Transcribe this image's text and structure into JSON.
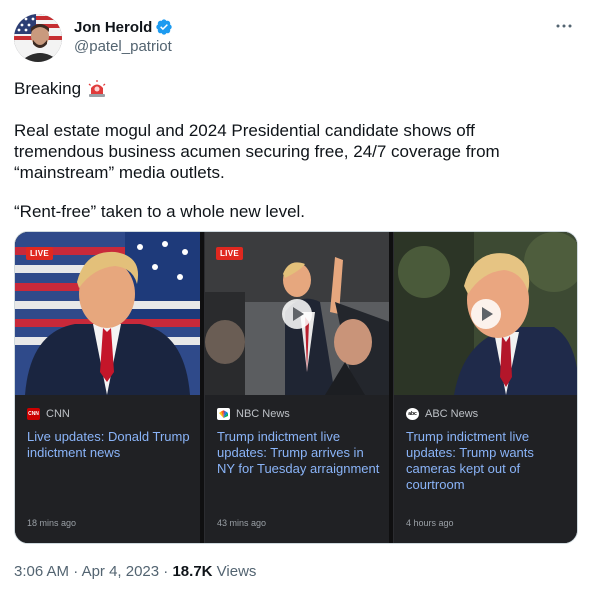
{
  "author": {
    "display_name": "Jon Herold",
    "handle": "@patel_patriot"
  },
  "tweet": {
    "line1": "Breaking",
    "para2_lines": [
      "Real estate mogul and 2024 Presidential candidate shows off",
      "tremendous business acumen securing free, 24/7 coverage from",
      "“mainstream” media outlets."
    ],
    "para3": "“Rent-free” taken to a whole new level."
  },
  "cards": [
    {
      "badge": "LIVE",
      "source": "CNN",
      "source_logo_text": "CNN",
      "headline": "Live updates: Donald Trump indictment news",
      "age": "18 mins ago"
    },
    {
      "badge": "LIVE",
      "source": "NBC News",
      "headline": "Trump indictment live updates: Trump arrives in NY for Tuesday arraignment",
      "age": "43 mins ago"
    },
    {
      "badge": "",
      "source": "ABC News",
      "source_logo_text": "abc",
      "headline": "Trump indictment live updates: Trump wants cameras kept out of courtroom",
      "age": "4 hours ago"
    }
  ],
  "meta": {
    "time": "3:06 AM",
    "sep1": " · ",
    "date": "Apr 4, 2023",
    "sep2": " · ",
    "views_count": "18.7K",
    "views_label": " Views"
  },
  "colors": {
    "verified": "#1d9bf0",
    "card_bg": "#202124",
    "headline_link": "#8ab4f8",
    "live_badge": "#e0281f"
  },
  "icons": [
    "verified-badge-icon",
    "more-options-icon",
    "siren-emoji-icon",
    "play-icon",
    "cnn-logo-icon",
    "nbc-logo-icon",
    "abc-logo-icon"
  ]
}
